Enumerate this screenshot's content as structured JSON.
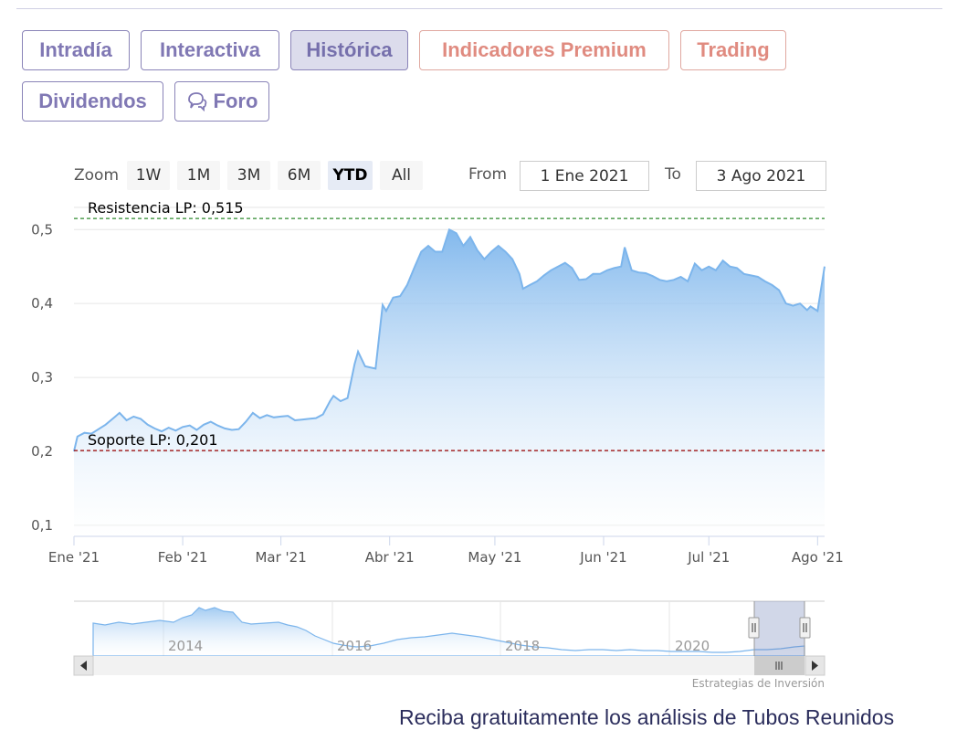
{
  "tabs": [
    {
      "label": "Intradía",
      "state": "normal"
    },
    {
      "label": "Interactiva",
      "state": "normal"
    },
    {
      "label": "Histórica",
      "state": "active"
    },
    {
      "label": "Indicadores Premium",
      "state": "premium"
    },
    {
      "label": "Trading",
      "state": "premium"
    },
    {
      "label": "Dividendos",
      "state": "normal"
    },
    {
      "label": "Foro",
      "state": "normal",
      "icon": "chat-bubbles-icon"
    }
  ],
  "range_selector": {
    "zoom_label": "Zoom",
    "buttons": [
      "1W",
      "1M",
      "3M",
      "6M",
      "YTD",
      "All"
    ],
    "selected": "YTD",
    "from_label": "From",
    "from_value": "1 Ene 2021",
    "to_label": "To",
    "to_value": "3 Ago 2021"
  },
  "chart_data": {
    "type": "area",
    "title": "",
    "xlabel": "",
    "ylabel": "",
    "x_tick_labels": [
      "Ene '21",
      "Feb '21",
      "Mar '21",
      "Abr '21",
      "May '21",
      "Jun '21",
      "Jul '21",
      "Ago '21"
    ],
    "y_tick_labels": [
      "0,1",
      "0,2",
      "0,3",
      "0,4",
      "0,5"
    ],
    "y_ticks": [
      0.1,
      0.2,
      0.3,
      0.4,
      0.5
    ],
    "ylim": [
      0.085,
      0.53
    ],
    "x_range_days": [
      0,
      214
    ],
    "grid": true,
    "series": [
      {
        "points": [
          [
            0,
            0.2
          ],
          [
            1,
            0.22
          ],
          [
            3,
            0.225
          ],
          [
            5,
            0.224
          ],
          [
            7,
            0.23
          ],
          [
            9,
            0.236
          ],
          [
            11,
            0.244
          ],
          [
            13,
            0.252
          ],
          [
            15,
            0.242
          ],
          [
            17,
            0.247
          ],
          [
            19,
            0.244
          ],
          [
            21,
            0.236
          ],
          [
            23,
            0.231
          ],
          [
            25,
            0.227
          ],
          [
            27,
            0.232
          ],
          [
            29,
            0.228
          ],
          [
            31,
            0.233
          ],
          [
            33,
            0.235
          ],
          [
            35,
            0.229
          ],
          [
            37,
            0.236
          ],
          [
            39,
            0.24
          ],
          [
            41,
            0.235
          ],
          [
            43,
            0.231
          ],
          [
            45,
            0.229
          ],
          [
            47,
            0.23
          ],
          [
            49,
            0.24
          ],
          [
            51,
            0.252
          ],
          [
            53,
            0.245
          ],
          [
            55,
            0.249
          ],
          [
            57,
            0.246
          ],
          [
            59,
            0.247
          ],
          [
            61,
            0.248
          ],
          [
            63,
            0.242
          ],
          [
            65,
            0.243
          ],
          [
            67,
            0.244
          ],
          [
            69,
            0.245
          ],
          [
            71,
            0.25
          ],
          [
            73,
            0.268
          ],
          [
            74,
            0.275
          ],
          [
            76,
            0.268
          ],
          [
            78,
            0.272
          ],
          [
            80,
            0.318
          ],
          [
            81,
            0.335
          ],
          [
            83,
            0.315
          ],
          [
            85,
            0.313
          ],
          [
            86,
            0.312
          ],
          [
            88,
            0.398
          ],
          [
            89,
            0.39
          ],
          [
            91,
            0.408
          ],
          [
            93,
            0.41
          ],
          [
            95,
            0.425
          ],
          [
            97,
            0.448
          ],
          [
            99,
            0.47
          ],
          [
            101,
            0.478
          ],
          [
            103,
            0.47
          ],
          [
            105,
            0.47
          ],
          [
            107,
            0.5
          ],
          [
            109,
            0.495
          ],
          [
            111,
            0.478
          ],
          [
            113,
            0.49
          ],
          [
            115,
            0.472
          ],
          [
            117,
            0.46
          ],
          [
            119,
            0.47
          ],
          [
            121,
            0.478
          ],
          [
            123,
            0.47
          ],
          [
            125,
            0.46
          ],
          [
            127,
            0.44
          ],
          [
            128,
            0.42
          ],
          [
            130,
            0.425
          ],
          [
            132,
            0.43
          ],
          [
            134,
            0.438
          ],
          [
            136,
            0.445
          ],
          [
            138,
            0.45
          ],
          [
            140,
            0.455
          ],
          [
            142,
            0.448
          ],
          [
            144,
            0.432
          ],
          [
            146,
            0.433
          ],
          [
            148,
            0.44
          ],
          [
            150,
            0.44
          ],
          [
            152,
            0.445
          ],
          [
            154,
            0.448
          ],
          [
            156,
            0.45
          ],
          [
            157,
            0.476
          ],
          [
            159,
            0.445
          ],
          [
            161,
            0.442
          ],
          [
            163,
            0.441
          ],
          [
            165,
            0.437
          ],
          [
            167,
            0.432
          ],
          [
            169,
            0.43
          ],
          [
            171,
            0.432
          ],
          [
            173,
            0.436
          ],
          [
            175,
            0.43
          ],
          [
            177,
            0.454
          ],
          [
            179,
            0.445
          ],
          [
            181,
            0.45
          ],
          [
            183,
            0.445
          ],
          [
            185,
            0.458
          ],
          [
            187,
            0.45
          ],
          [
            189,
            0.448
          ],
          [
            191,
            0.44
          ],
          [
            193,
            0.438
          ],
          [
            195,
            0.436
          ],
          [
            197,
            0.43
          ],
          [
            199,
            0.425
          ],
          [
            201,
            0.418
          ],
          [
            203,
            0.4
          ],
          [
            205,
            0.397
          ],
          [
            207,
            0.4
          ],
          [
            209,
            0.391
          ],
          [
            210,
            0.396
          ],
          [
            212,
            0.39
          ],
          [
            214,
            0.45
          ]
        ]
      }
    ],
    "reference_lines": [
      {
        "label": "Resistencia LP: 0,515",
        "value": 0.515,
        "color": "#2e8b2e",
        "style": "dashed"
      },
      {
        "label": "Soporte LP: 0,201",
        "value": 0.201,
        "color": "#990000",
        "style": "dashed"
      }
    ],
    "navigator": {
      "x_tick_labels": [
        "2014",
        "2016",
        "2018",
        "2020"
      ]
    },
    "colors": {
      "line": "#7cb5ec",
      "fill_top": "#7cb5ec"
    }
  },
  "credit": "Estrategias de Inversión",
  "cta_text": "Reciba gratuitamente los análisis de Tubos Reunidos"
}
